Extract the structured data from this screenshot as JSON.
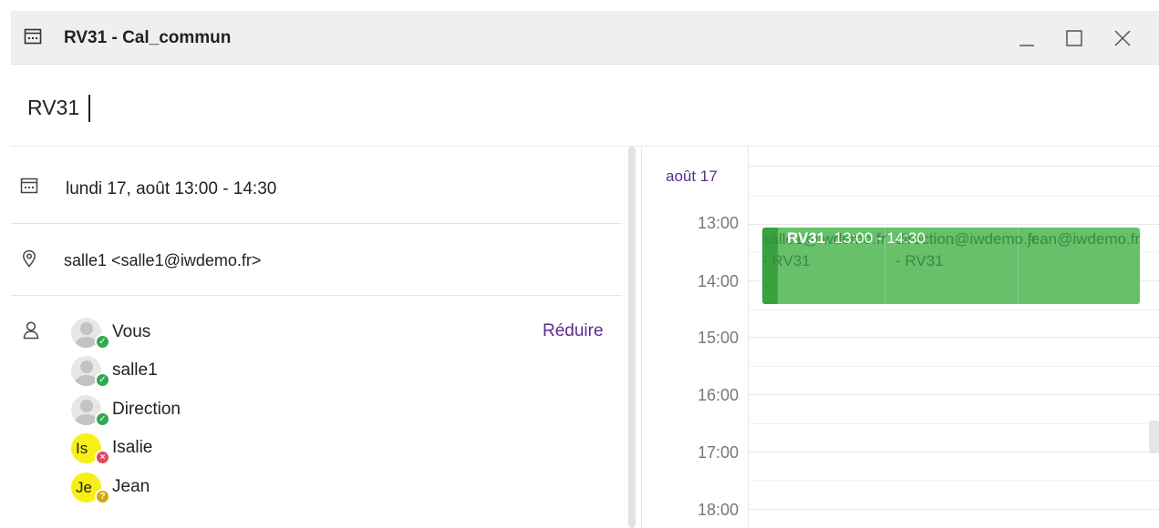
{
  "window": {
    "title": "RV31 - Cal_commun",
    "calendar_icon": "calendar-icon",
    "controls": [
      "minimize-icon",
      "maximize-icon",
      "close-icon"
    ]
  },
  "subject": {
    "value": "RV31"
  },
  "details": {
    "date_text": "lundi 17, août 13:00 - 14:30",
    "location_text": "salle1 <salle1@iwdemo.fr>",
    "reduce_label": "Réduire"
  },
  "attendees": [
    {
      "name": "Vous",
      "avatar": "default-avatar",
      "initials": "",
      "status": "accepted"
    },
    {
      "name": "salle1",
      "avatar": "default-avatar",
      "initials": "",
      "status": "accepted"
    },
    {
      "name": "Direction",
      "avatar": "default-avatar",
      "initials": "",
      "status": "accepted"
    },
    {
      "name": "Isalie",
      "avatar": "initials-avatar",
      "initials": "Is",
      "status": "declined"
    },
    {
      "name": "Jean",
      "avatar": "initials-avatar",
      "initials": "Je",
      "status": "tentative"
    }
  ],
  "calendar": {
    "day_label": "août 17",
    "hours": [
      "13:00",
      "14:00",
      "15:00",
      "16:00",
      "17:00",
      "18:00"
    ],
    "event": {
      "title": "RV31",
      "time": "13:00 - 14:30",
      "overlay_col1_line1": "salle1@iwdemo.fr",
      "overlay_col1_line2": "- RV31",
      "overlay_col2_line1": "direction@iwdemo.fr",
      "overlay_col2_line2": "- RV31",
      "overlay_col3_line1": "jean@iwdemo.fr"
    }
  },
  "colors": {
    "accent_purple": "#5b2d8e",
    "event_green": "#66c16a",
    "status_accepted": "#2eaa4f",
    "status_declined": "#e9455c",
    "status_tentative": "#d6a800",
    "initials_avatar_bg": "#f7ef16"
  }
}
